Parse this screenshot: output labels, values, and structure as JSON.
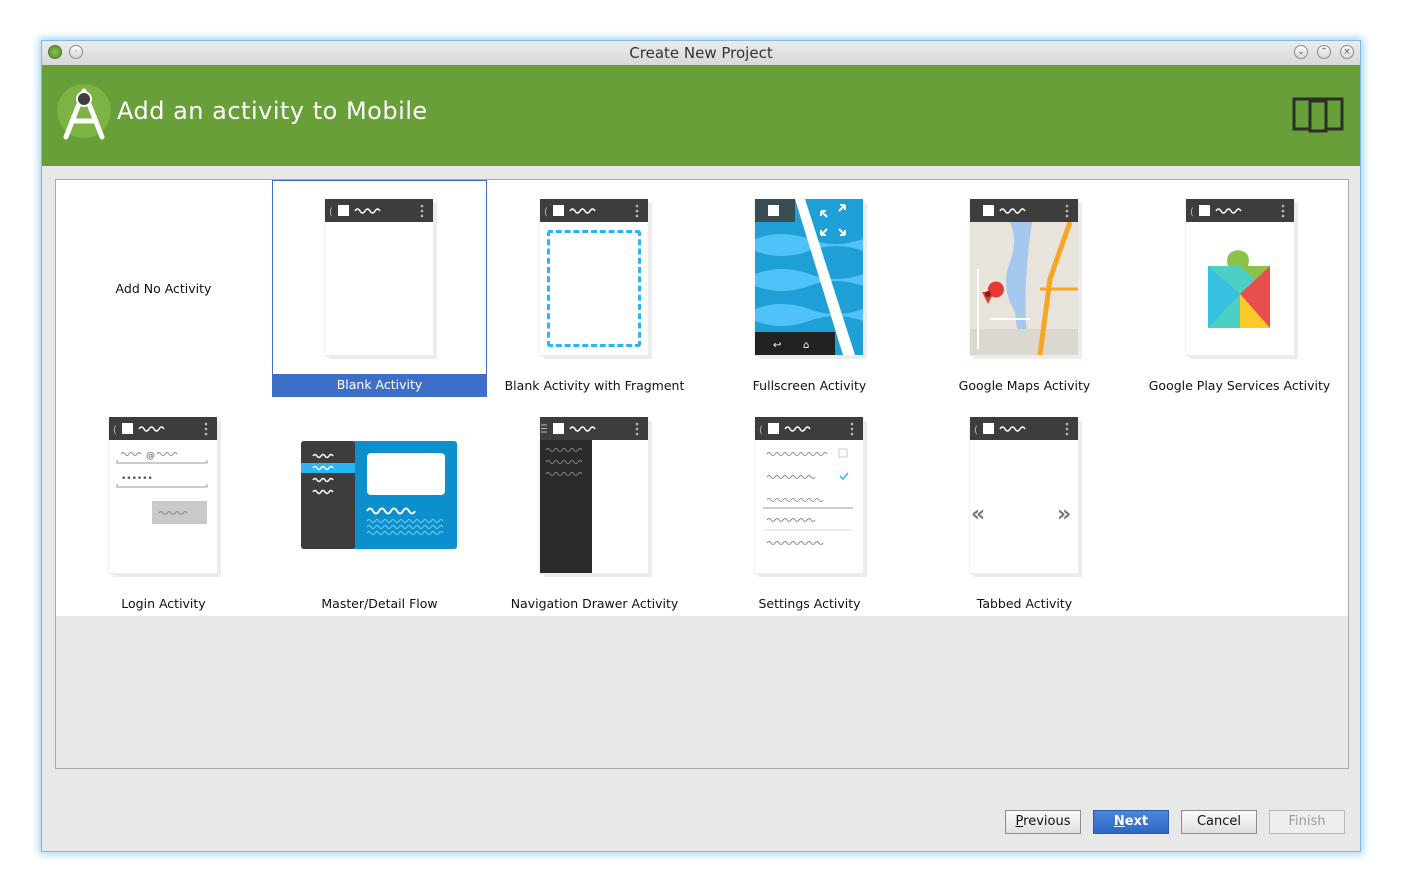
{
  "window": {
    "title": "Create New Project"
  },
  "header": {
    "title": "Add an activity to Mobile"
  },
  "activities": [
    {
      "label": "Add No Activity"
    },
    {
      "label": "Blank Activity",
      "selected": true
    },
    {
      "label": "Blank Activity with Fragment"
    },
    {
      "label": "Fullscreen Activity"
    },
    {
      "label": "Google Maps Activity"
    },
    {
      "label": "Google Play Services Activity"
    },
    {
      "label": "Login Activity"
    },
    {
      "label": "Master/Detail Flow"
    },
    {
      "label": "Navigation Drawer Activity"
    },
    {
      "label": "Settings Activity"
    },
    {
      "label": "Tabbed Activity"
    }
  ],
  "buttons": {
    "previous": {
      "mnemonic": "P",
      "rest": "revious"
    },
    "next": {
      "mnemonic": "N",
      "rest": "ext"
    },
    "cancel": "Cancel",
    "finish": "Finish"
  },
  "colors": {
    "header": "#689f38",
    "selection": "#3d6fc8",
    "accent": "#29b6f6"
  },
  "icons": [
    "android-studio-logo-icon",
    "device-form-factor-icon",
    "minimize-icon",
    "maximize-icon",
    "close-icon"
  ]
}
